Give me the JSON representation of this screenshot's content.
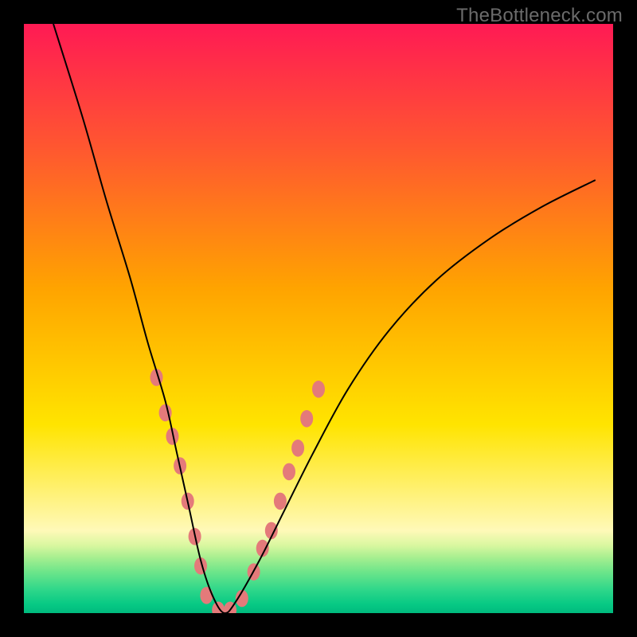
{
  "watermark": "TheBottleneck.com",
  "chart_data": {
    "type": "line",
    "title": "",
    "xlabel": "",
    "ylabel": "",
    "xlim": [
      0,
      100
    ],
    "ylim": [
      0,
      100
    ],
    "grid": false,
    "legend": null,
    "background": {
      "top": [
        {
          "stop": 0.0,
          "color": "#ff1a54"
        },
        {
          "stop": 0.22,
          "color": "#ff5a2e"
        },
        {
          "stop": 0.45,
          "color": "#ffa400"
        },
        {
          "stop": 0.68,
          "color": "#ffe400"
        },
        {
          "stop": 0.86,
          "color": "#fff9b8"
        }
      ],
      "bottom": [
        {
          "stop": 0.86,
          "color": "#fff9b8"
        },
        {
          "stop": 0.885,
          "color": "#d9f7a0"
        },
        {
          "stop": 0.905,
          "color": "#a8ef90"
        },
        {
          "stop": 0.93,
          "color": "#6de58a"
        },
        {
          "stop": 0.96,
          "color": "#2fd78a"
        },
        {
          "stop": 0.985,
          "color": "#07c984"
        },
        {
          "stop": 1.0,
          "color": "#00ba7e"
        }
      ]
    },
    "series": [
      {
        "name": "bottleneck-curve",
        "color": "#000000",
        "stroke_width": 2,
        "x": [
          5,
          10,
          14,
          18,
          21,
          24,
          26,
          28,
          30,
          32,
          34,
          36,
          40,
          44,
          49,
          55,
          62,
          70,
          79,
          88,
          97
        ],
        "values": [
          100,
          84,
          70,
          57,
          46,
          36,
          27,
          18,
          9,
          3,
          0,
          2,
          9,
          17,
          27,
          38,
          48,
          56.5,
          63.5,
          69,
          73.5
        ]
      }
    ],
    "overlays": {
      "dot_clusters": {
        "color": "#e47a7a",
        "radius": 8,
        "points": [
          {
            "x": 22.5,
            "y": 40
          },
          {
            "x": 24,
            "y": 34
          },
          {
            "x": 25.2,
            "y": 30
          },
          {
            "x": 26.5,
            "y": 25
          },
          {
            "x": 27.8,
            "y": 19
          },
          {
            "x": 29,
            "y": 13
          },
          {
            "x": 30,
            "y": 8
          },
          {
            "x": 31,
            "y": 3
          },
          {
            "x": 33,
            "y": 0.5
          },
          {
            "x": 35,
            "y": 0.5
          },
          {
            "x": 37,
            "y": 2.5
          },
          {
            "x": 39,
            "y": 7
          },
          {
            "x": 40.5,
            "y": 11
          },
          {
            "x": 42,
            "y": 14
          },
          {
            "x": 43.5,
            "y": 19
          },
          {
            "x": 45,
            "y": 24
          },
          {
            "x": 46.5,
            "y": 28
          },
          {
            "x": 48,
            "y": 33
          },
          {
            "x": 50,
            "y": 38
          }
        ]
      }
    }
  }
}
